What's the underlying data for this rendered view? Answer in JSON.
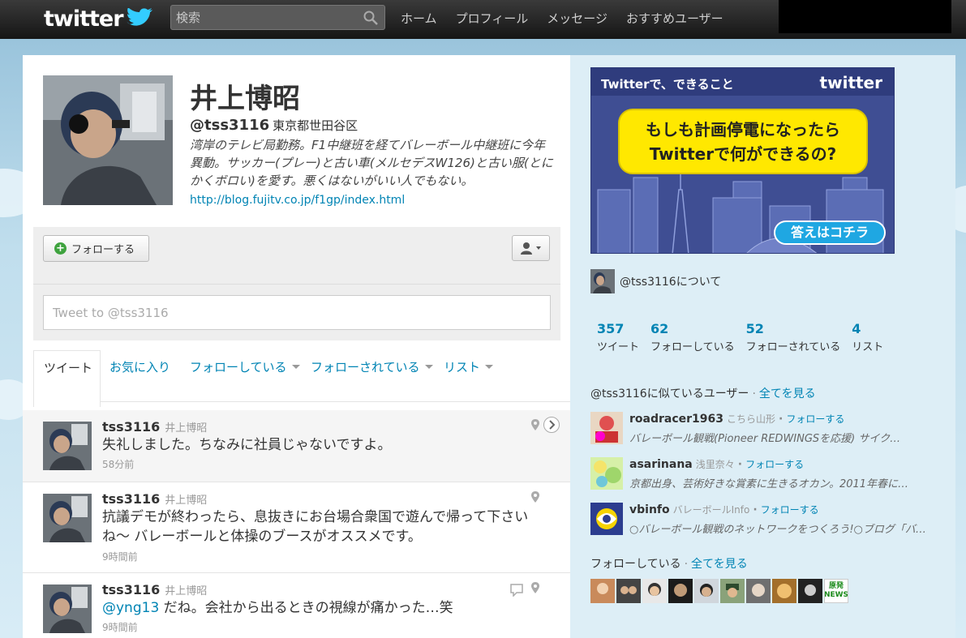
{
  "topbar": {
    "logo_text": "twitter",
    "search_placeholder": "検索",
    "nav": [
      "ホーム",
      "プロフィール",
      "メッセージ",
      "おすすめユーザー"
    ]
  },
  "profile": {
    "name": "井上博昭",
    "handle": "@tss3116",
    "location": "東京都世田谷区",
    "bio": "湾岸のテレビ局勤務。F1中継班を経てバレーボール中継班に今年異動。サッカー(プレー)と古い車(メルセデスW126)と古い服(とにかくボロい)を愛す。悪くはないがいい人でもない。",
    "url": "http://blog.fujitv.co.jp/f1gp/index.html",
    "follow_label": "フォローする",
    "tweet_placeholder": "Tweet to @tss3116"
  },
  "tabs": {
    "active": "ツイート",
    "items": [
      "お気に入り",
      "フォローしている",
      "フォローされている",
      "リスト"
    ]
  },
  "tweets": [
    {
      "user": "tss3116",
      "real": "井上博昭",
      "text": "失礼しました。ちなみに社員じゃないですよ。",
      "time": "58分前"
    },
    {
      "user": "tss3116",
      "real": "井上博昭",
      "text": "抗議デモが終わったら、息抜きにお台場合衆国で遊んで帰って下さいね〜 バレーボールと体操のブースがオススメです。",
      "time": "9時間前"
    },
    {
      "user": "tss3116",
      "real": "井上博昭",
      "mention": "@yng13",
      "text": " だね。会社から出るときの視線が痛かった…笑",
      "time": "9時間前"
    }
  ],
  "ad": {
    "top_left": "Twitterで、できること",
    "logo": "twitter",
    "line1": "もしも計画停電になったら",
    "line2": "Twitterで何ができるの?",
    "cta": "答えはコチラ"
  },
  "about": "@tss3116について",
  "stats": [
    {
      "num": "357",
      "label": "ツイート"
    },
    {
      "num": "62",
      "label": "フォローしている"
    },
    {
      "num": "52",
      "label": "フォローされている"
    },
    {
      "num": "4",
      "label": "リスト"
    }
  ],
  "similar": {
    "title": "@tss3116に似ているユーザー",
    "see_all": "全てを見る",
    "follow_label": "フォローする",
    "users": [
      {
        "name": "roadracer1963",
        "real": "こちら山形",
        "bio": "バレーボール観戦(Pioneer REDWINGSを応援) サイク…"
      },
      {
        "name": "asarinana",
        "real": "浅里奈々",
        "bio": "京都出身、芸術好きな賞素に生きるオカン。2011年春に…"
      },
      {
        "name": "vbinfo",
        "real": "バレーボールInfo",
        "bio": "○バレーボール観戦のネットワークをつくろう!○ブログ「バ…"
      }
    ]
  },
  "following": {
    "title": "フォローしている",
    "see_all": "全てを見る",
    "badge_line1": "原発",
    "badge_line2": "NEWS"
  },
  "colors": {
    "link": "#0084b4",
    "background": "#c0deed",
    "topbar": "#1f1f1f",
    "ad": "#3f4e93",
    "ad_bubble": "#ffe800"
  }
}
